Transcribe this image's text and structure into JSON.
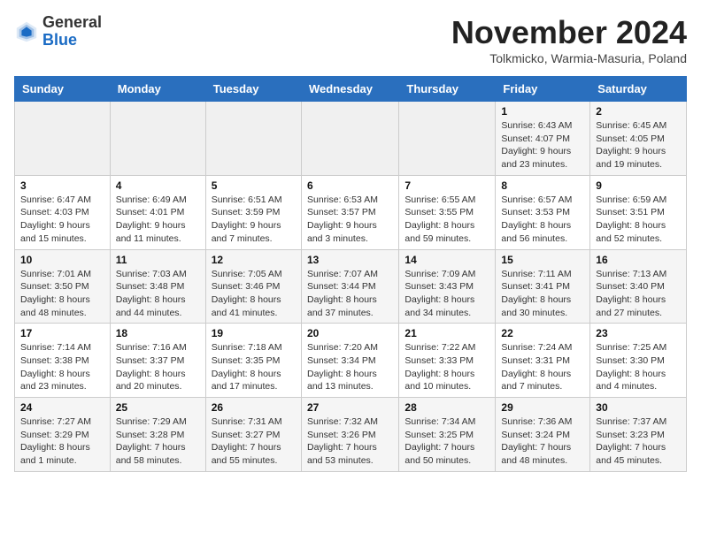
{
  "header": {
    "logo_general": "General",
    "logo_blue": "Blue",
    "month_title": "November 2024",
    "location": "Tolkmicko, Warmia-Masuria, Poland"
  },
  "days_of_week": [
    "Sunday",
    "Monday",
    "Tuesday",
    "Wednesday",
    "Thursday",
    "Friday",
    "Saturday"
  ],
  "weeks": [
    [
      {
        "day": "",
        "info": ""
      },
      {
        "day": "",
        "info": ""
      },
      {
        "day": "",
        "info": ""
      },
      {
        "day": "",
        "info": ""
      },
      {
        "day": "",
        "info": ""
      },
      {
        "day": "1",
        "info": "Sunrise: 6:43 AM\nSunset: 4:07 PM\nDaylight: 9 hours and 23 minutes."
      },
      {
        "day": "2",
        "info": "Sunrise: 6:45 AM\nSunset: 4:05 PM\nDaylight: 9 hours and 19 minutes."
      }
    ],
    [
      {
        "day": "3",
        "info": "Sunrise: 6:47 AM\nSunset: 4:03 PM\nDaylight: 9 hours and 15 minutes."
      },
      {
        "day": "4",
        "info": "Sunrise: 6:49 AM\nSunset: 4:01 PM\nDaylight: 9 hours and 11 minutes."
      },
      {
        "day": "5",
        "info": "Sunrise: 6:51 AM\nSunset: 3:59 PM\nDaylight: 9 hours and 7 minutes."
      },
      {
        "day": "6",
        "info": "Sunrise: 6:53 AM\nSunset: 3:57 PM\nDaylight: 9 hours and 3 minutes."
      },
      {
        "day": "7",
        "info": "Sunrise: 6:55 AM\nSunset: 3:55 PM\nDaylight: 8 hours and 59 minutes."
      },
      {
        "day": "8",
        "info": "Sunrise: 6:57 AM\nSunset: 3:53 PM\nDaylight: 8 hours and 56 minutes."
      },
      {
        "day": "9",
        "info": "Sunrise: 6:59 AM\nSunset: 3:51 PM\nDaylight: 8 hours and 52 minutes."
      }
    ],
    [
      {
        "day": "10",
        "info": "Sunrise: 7:01 AM\nSunset: 3:50 PM\nDaylight: 8 hours and 48 minutes."
      },
      {
        "day": "11",
        "info": "Sunrise: 7:03 AM\nSunset: 3:48 PM\nDaylight: 8 hours and 44 minutes."
      },
      {
        "day": "12",
        "info": "Sunrise: 7:05 AM\nSunset: 3:46 PM\nDaylight: 8 hours and 41 minutes."
      },
      {
        "day": "13",
        "info": "Sunrise: 7:07 AM\nSunset: 3:44 PM\nDaylight: 8 hours and 37 minutes."
      },
      {
        "day": "14",
        "info": "Sunrise: 7:09 AM\nSunset: 3:43 PM\nDaylight: 8 hours and 34 minutes."
      },
      {
        "day": "15",
        "info": "Sunrise: 7:11 AM\nSunset: 3:41 PM\nDaylight: 8 hours and 30 minutes."
      },
      {
        "day": "16",
        "info": "Sunrise: 7:13 AM\nSunset: 3:40 PM\nDaylight: 8 hours and 27 minutes."
      }
    ],
    [
      {
        "day": "17",
        "info": "Sunrise: 7:14 AM\nSunset: 3:38 PM\nDaylight: 8 hours and 23 minutes."
      },
      {
        "day": "18",
        "info": "Sunrise: 7:16 AM\nSunset: 3:37 PM\nDaylight: 8 hours and 20 minutes."
      },
      {
        "day": "19",
        "info": "Sunrise: 7:18 AM\nSunset: 3:35 PM\nDaylight: 8 hours and 17 minutes."
      },
      {
        "day": "20",
        "info": "Sunrise: 7:20 AM\nSunset: 3:34 PM\nDaylight: 8 hours and 13 minutes."
      },
      {
        "day": "21",
        "info": "Sunrise: 7:22 AM\nSunset: 3:33 PM\nDaylight: 8 hours and 10 minutes."
      },
      {
        "day": "22",
        "info": "Sunrise: 7:24 AM\nSunset: 3:31 PM\nDaylight: 8 hours and 7 minutes."
      },
      {
        "day": "23",
        "info": "Sunrise: 7:25 AM\nSunset: 3:30 PM\nDaylight: 8 hours and 4 minutes."
      }
    ],
    [
      {
        "day": "24",
        "info": "Sunrise: 7:27 AM\nSunset: 3:29 PM\nDaylight: 8 hours and 1 minute."
      },
      {
        "day": "25",
        "info": "Sunrise: 7:29 AM\nSunset: 3:28 PM\nDaylight: 7 hours and 58 minutes."
      },
      {
        "day": "26",
        "info": "Sunrise: 7:31 AM\nSunset: 3:27 PM\nDaylight: 7 hours and 55 minutes."
      },
      {
        "day": "27",
        "info": "Sunrise: 7:32 AM\nSunset: 3:26 PM\nDaylight: 7 hours and 53 minutes."
      },
      {
        "day": "28",
        "info": "Sunrise: 7:34 AM\nSunset: 3:25 PM\nDaylight: 7 hours and 50 minutes."
      },
      {
        "day": "29",
        "info": "Sunrise: 7:36 AM\nSunset: 3:24 PM\nDaylight: 7 hours and 48 minutes."
      },
      {
        "day": "30",
        "info": "Sunrise: 7:37 AM\nSunset: 3:23 PM\nDaylight: 7 hours and 45 minutes."
      }
    ]
  ]
}
